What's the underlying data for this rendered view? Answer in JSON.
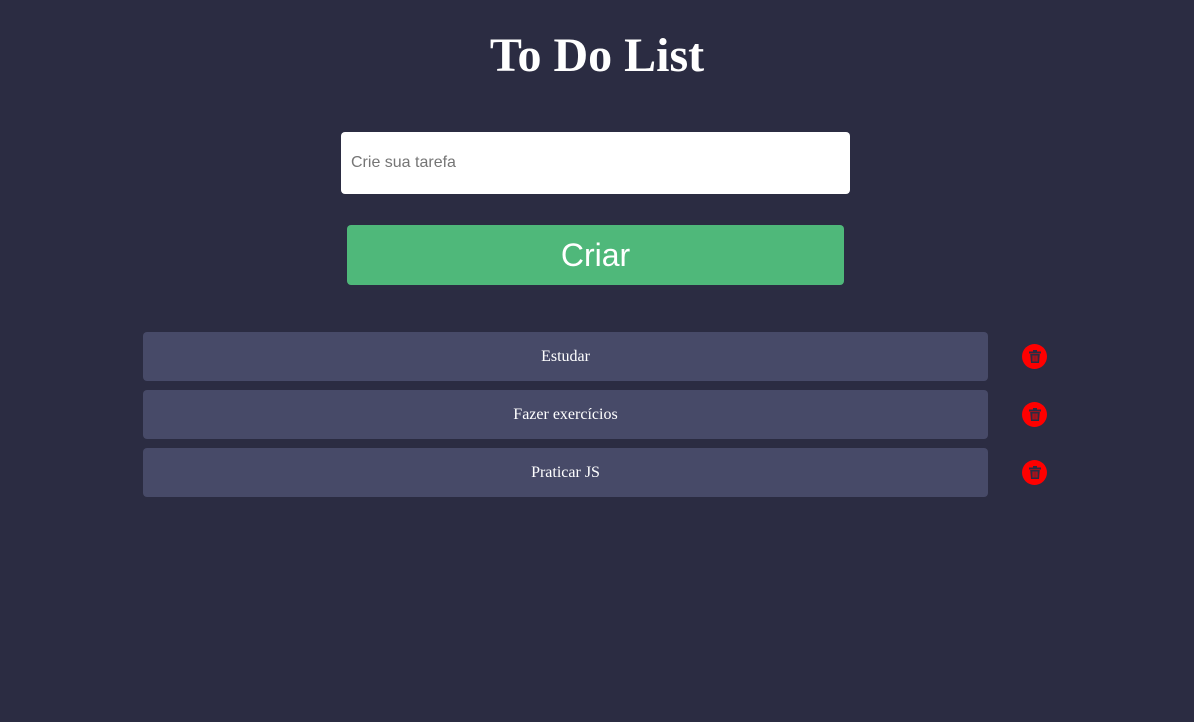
{
  "header": {
    "title": "To Do List"
  },
  "form": {
    "input_placeholder": "Crie sua tarefa",
    "input_value": "",
    "create_label": "Criar"
  },
  "tasks": [
    {
      "label": "Estudar"
    },
    {
      "label": "Fazer exercícios"
    },
    {
      "label": "Praticar JS"
    }
  ],
  "icons": {
    "delete": "trash-icon"
  },
  "colors": {
    "background": "#2b2c42",
    "task_background": "#474a68",
    "create_button": "#4fb87a",
    "delete_icon": "#ff0000"
  }
}
